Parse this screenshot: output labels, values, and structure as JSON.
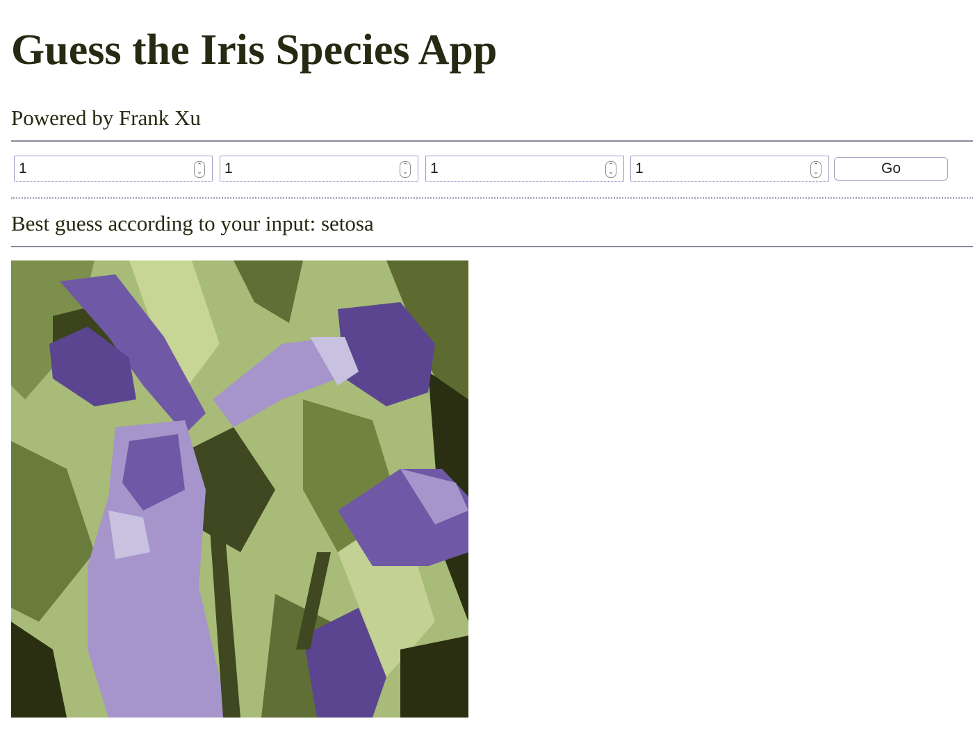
{
  "header": {
    "title": "Guess the Iris Species App",
    "subtitle": "Powered by Frank Xu"
  },
  "form": {
    "fields": [
      {
        "value": "1"
      },
      {
        "value": "1"
      },
      {
        "value": "1"
      },
      {
        "value": "1"
      }
    ],
    "go_label": "Go"
  },
  "result": {
    "text": "Best guess according to your input: setosa"
  },
  "image": {
    "subject": "iris flower photo",
    "colors": {
      "background_green": "#a8bb78",
      "dark_green": "#2a2f12",
      "petal_light": "#a595cb",
      "petal_dark": "#5b4590"
    }
  }
}
